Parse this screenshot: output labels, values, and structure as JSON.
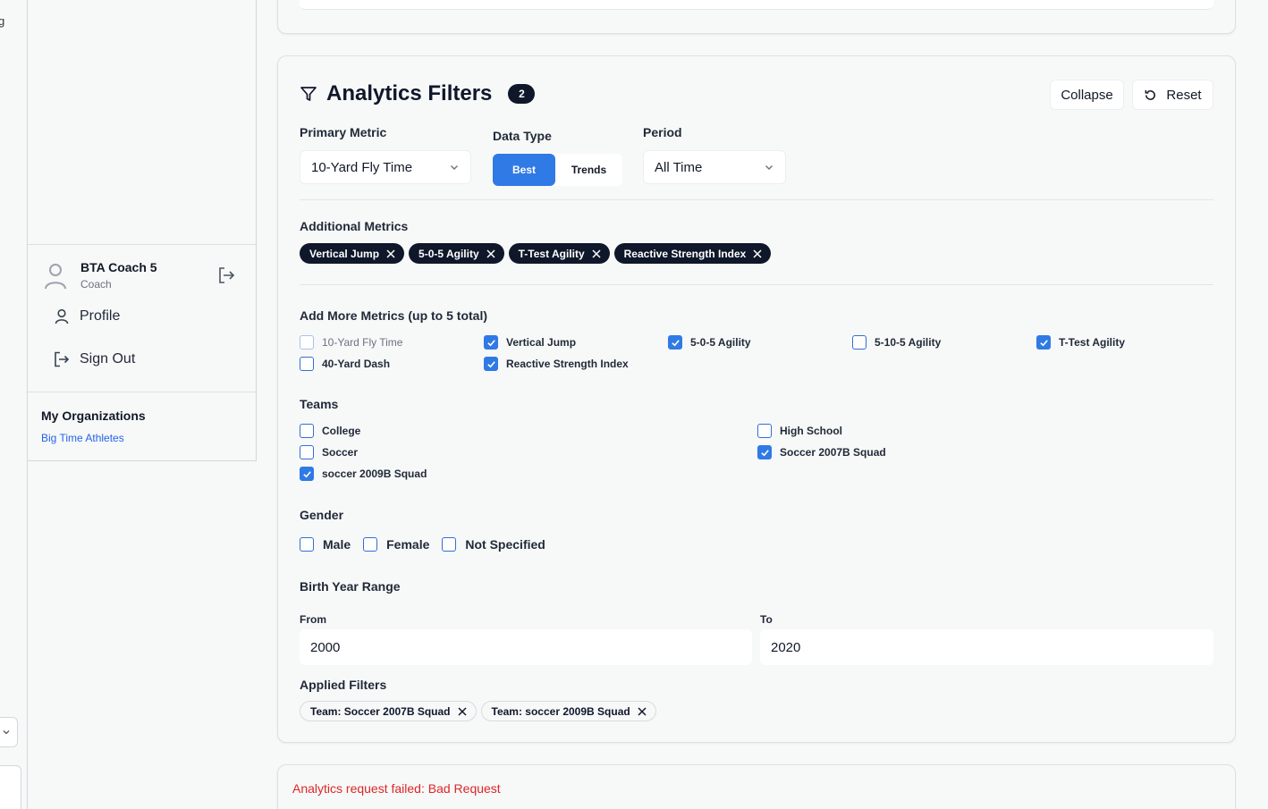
{
  "sidebar": {
    "user": {
      "name": "BTA Coach 5",
      "role": "Coach"
    },
    "menu": [
      {
        "label": "Profile",
        "icon": "user-icon"
      },
      {
        "label": "Sign Out",
        "icon": "logout-icon"
      }
    ],
    "organizations": {
      "title": "My Organizations",
      "items": [
        "Big Time Athletes"
      ]
    }
  },
  "filters": {
    "title": "Analytics Filters",
    "active_count": "2",
    "collapse_label": "Collapse",
    "reset_label": "Reset",
    "primary_metric": {
      "label": "Primary Metric",
      "value": "10-Yard Fly Time"
    },
    "data_type": {
      "label": "Data Type",
      "options": [
        "Best",
        "Trends"
      ],
      "selected": "Best"
    },
    "period": {
      "label": "Period",
      "value": "All Time"
    },
    "additional_metrics": {
      "label": "Additional Metrics",
      "chips": [
        "Vertical Jump",
        "5-0-5 Agility",
        "T-Test Agility",
        "Reactive Strength Index"
      ]
    },
    "add_more": {
      "label": "Add More Metrics (up to 5 total)",
      "options": [
        {
          "label": "10-Yard Fly Time",
          "checked": false,
          "disabled": true
        },
        {
          "label": "Vertical Jump",
          "checked": true
        },
        {
          "label": "5-0-5 Agility",
          "checked": true
        },
        {
          "label": "5-10-5 Agility",
          "checked": false
        },
        {
          "label": "T-Test Agility",
          "checked": true
        },
        {
          "label": "40-Yard Dash",
          "checked": false
        },
        {
          "label": "Reactive Strength Index",
          "checked": true
        }
      ]
    },
    "teams": {
      "label": "Teams",
      "options": [
        {
          "label": "College",
          "checked": false
        },
        {
          "label": "High School",
          "checked": false
        },
        {
          "label": "Soccer",
          "checked": false
        },
        {
          "label": "Soccer 2007B Squad",
          "checked": true
        },
        {
          "label": "soccer 2009B Squad",
          "checked": true
        }
      ]
    },
    "gender": {
      "label": "Gender",
      "options": [
        {
          "label": "Male",
          "checked": false
        },
        {
          "label": "Female",
          "checked": false
        },
        {
          "label": "Not Specified",
          "checked": false
        }
      ]
    },
    "birth_year": {
      "label": "Birth Year Range",
      "from_label": "From",
      "from_value": "2000",
      "to_label": "To",
      "to_value": "2020"
    },
    "applied": {
      "label": "Applied Filters",
      "chips": [
        "Team: Soccer 2007B Squad",
        "Team: soccer 2009B Squad"
      ]
    }
  },
  "error": {
    "message": "Analytics request failed: Bad Request"
  },
  "colors": {
    "accent": "#2f7ae5",
    "dark_chip": "#0f172a",
    "error": "#dc2626",
    "link": "#2563eb"
  }
}
